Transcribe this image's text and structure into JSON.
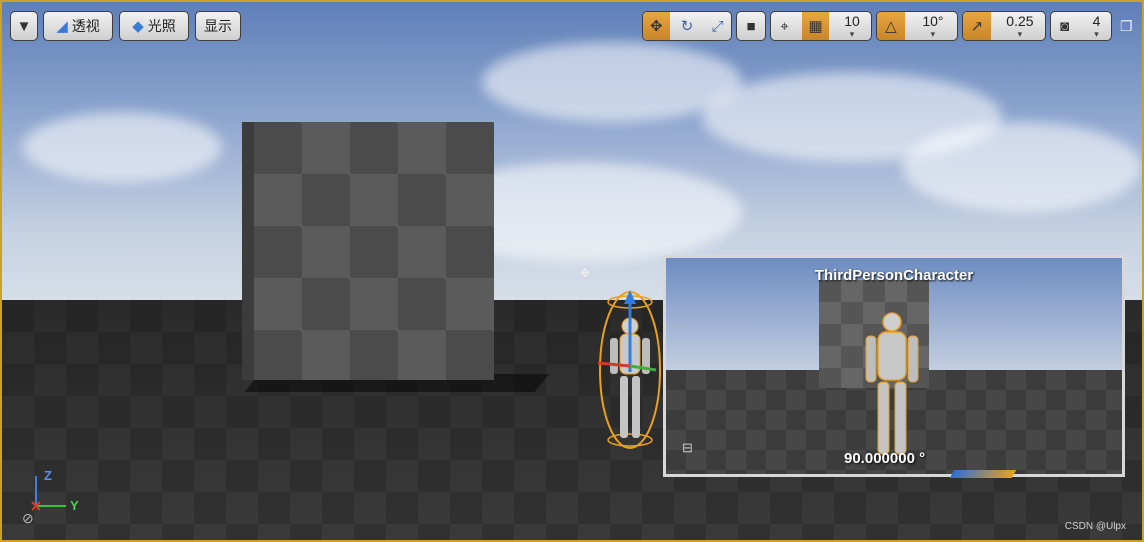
{
  "toolbar": {
    "view_mode_label": "透视",
    "lit_mode_label": "光照",
    "show_label": "显示",
    "grid_snap_value": "10",
    "rotation_snap_value": "10°",
    "scale_snap_value": "0.25",
    "camera_speed_value": "4"
  },
  "preview": {
    "title": "ThirdPersonCharacter",
    "rotation_readout": "90.000000 °"
  },
  "axes": {
    "z_label": "Z",
    "y_label": "Y"
  },
  "watermark": "CSDN @Ulpx",
  "colors": {
    "accent_orange": "#d9952f",
    "selection_outline": "#e8a020",
    "viewport_border": "#c9a227"
  }
}
